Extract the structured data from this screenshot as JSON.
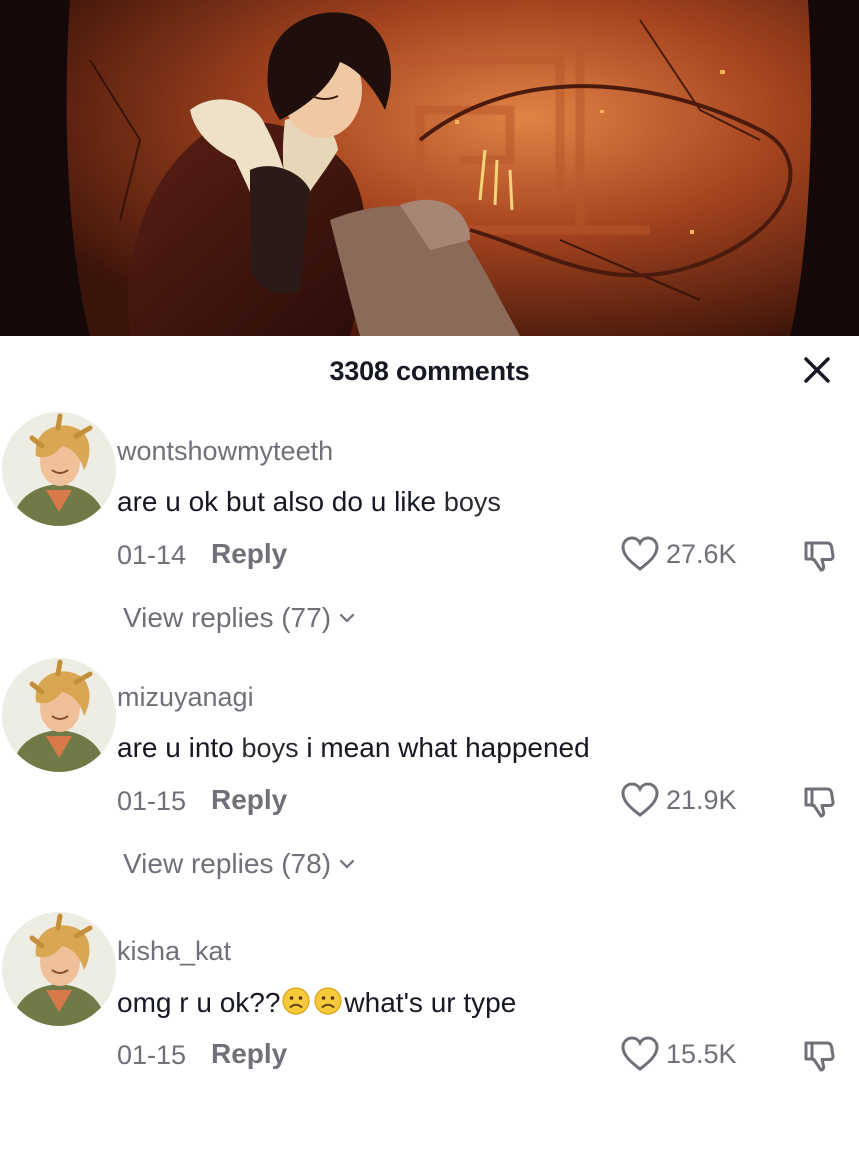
{
  "header": {
    "comment_count_label": "3308 comments"
  },
  "icons": {
    "close": "close-icon",
    "like": "heart-outline-icon",
    "dislike": "thumbs-down-icon",
    "expand": "chevron-down-icon",
    "emoji": "frowning-face-emoji"
  },
  "colors": {
    "text_primary": "#161823",
    "text_secondary": "#6f7078",
    "hero_glow": "#d8703a"
  },
  "comments": [
    {
      "username": "wontshowmyteeth",
      "text_before": "are u ok but also do u like ",
      "text_mid": "boys",
      "text_after": "",
      "date": "01-14",
      "reply_label": "Reply",
      "likes": "27.6K",
      "view_replies": "View replies (77)"
    },
    {
      "username": "mizuyanagi",
      "text_before": "are u into ",
      "text_mid": "boys",
      "text_after": " i mean what happened",
      "date": "01-15",
      "reply_label": "Reply",
      "likes": "21.9K",
      "view_replies": "View replies (78)"
    },
    {
      "username": "kisha_kat",
      "text_before": "omg r u ok??",
      "text_after": "what's ur type",
      "date": "01-15",
      "reply_label": "Reply",
      "likes": "15.5K"
    }
  ]
}
